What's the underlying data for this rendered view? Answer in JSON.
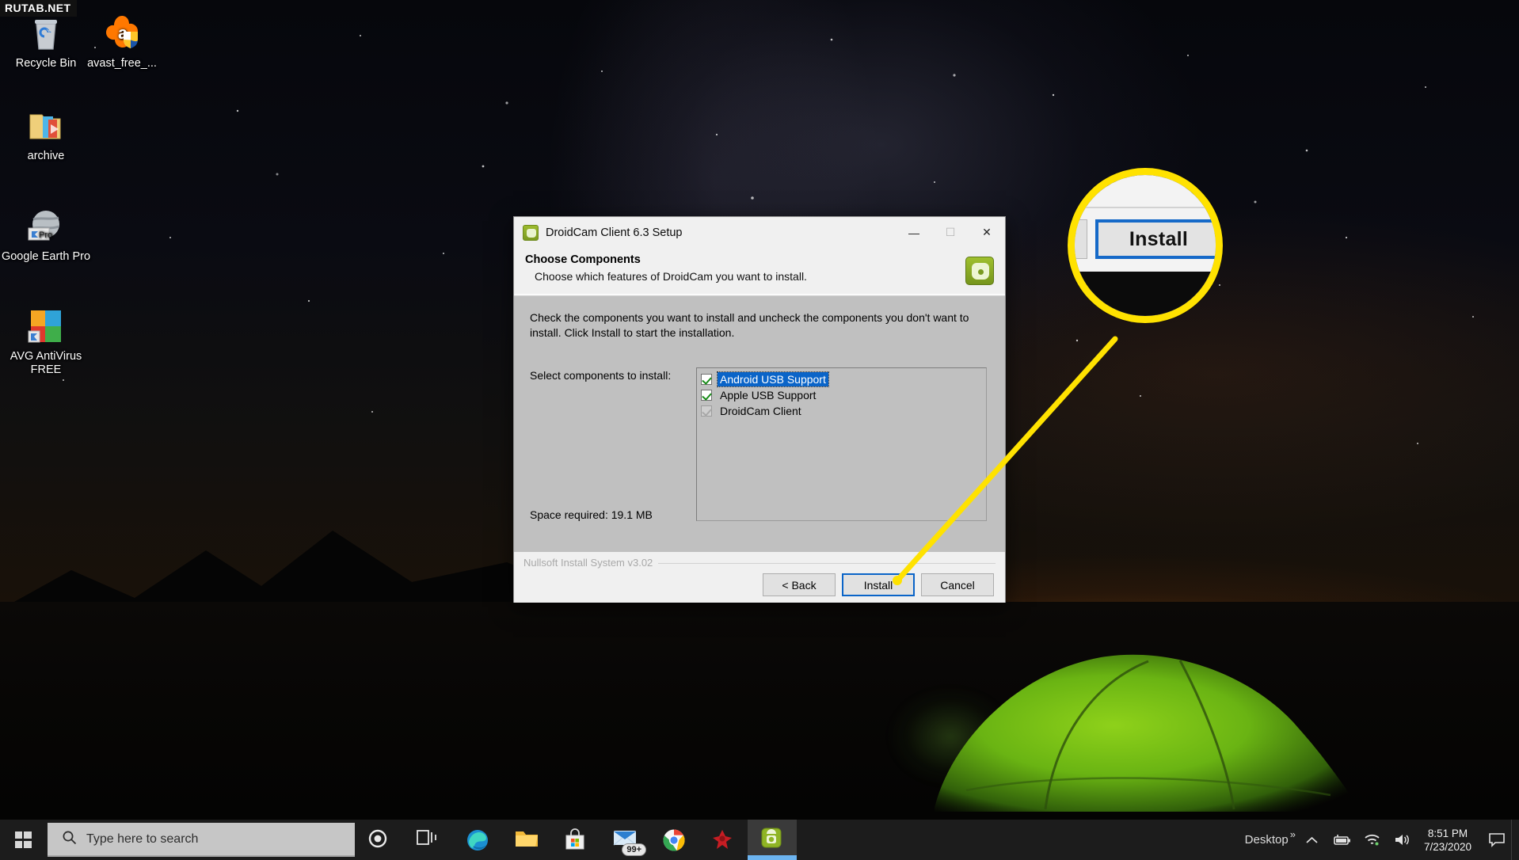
{
  "watermark": "RUTAB.NET",
  "desktop": {
    "icons": [
      {
        "name": "recycle-bin",
        "label": "Recycle Bin"
      },
      {
        "name": "avast-installer",
        "label": "avast_free_..."
      },
      {
        "name": "archive-folder",
        "label": "archive"
      },
      {
        "name": "google-earth-pro",
        "label": "Google Earth Pro"
      },
      {
        "name": "avg-antivirus-free",
        "label": "AVG AntiVirus FREE"
      }
    ]
  },
  "dialog": {
    "title": "DroidCam Client 6.3 Setup",
    "window_buttons": {
      "minimize": "—",
      "maximize": "☐",
      "close": "✕"
    },
    "header": {
      "title": "Choose Components",
      "subtitle": "Choose which features of DroidCam you want to install."
    },
    "body": {
      "intro": "Check the components you want to install and uncheck the components you don't want to install. Click Install to start the installation.",
      "select_label": "Select components to install:",
      "components": [
        {
          "label": "Android USB Support",
          "checked": true,
          "selected": true,
          "disabled": false
        },
        {
          "label": "Apple USB Support",
          "checked": true,
          "selected": false,
          "disabled": false
        },
        {
          "label": "DroidCam Client",
          "checked": true,
          "selected": false,
          "disabled": true
        }
      ],
      "space_required": "Space required: 19.1 MB"
    },
    "footer": {
      "branding": "Nullsoft Install System v3.02",
      "back_label": "< Back",
      "install_label": "Install",
      "cancel_label": "Cancel"
    }
  },
  "callout": {
    "magnified_label": "Install",
    "ring_color": "#ffe200",
    "focus_color": "#1569c8"
  },
  "taskbar": {
    "search_placeholder": "Type here to search",
    "items": [
      {
        "name": "cortana",
        "label": "Cortana"
      },
      {
        "name": "task-view",
        "label": "Task View"
      },
      {
        "name": "microsoft-edge",
        "label": "Microsoft Edge"
      },
      {
        "name": "file-explorer",
        "label": "File Explorer"
      },
      {
        "name": "microsoft-store",
        "label": "Microsoft Store"
      },
      {
        "name": "mail",
        "label": "Mail",
        "badge": "99+"
      },
      {
        "name": "google-chrome",
        "label": "Google Chrome"
      },
      {
        "name": "red-app",
        "label": "App"
      },
      {
        "name": "droidcam-client",
        "label": "DroidCam Client",
        "active": true
      }
    ],
    "tray": {
      "desktop_label": "Desktop",
      "overflow": "»",
      "chevron": "⌃",
      "time": "8:51 PM",
      "date": "7/23/2020"
    }
  }
}
